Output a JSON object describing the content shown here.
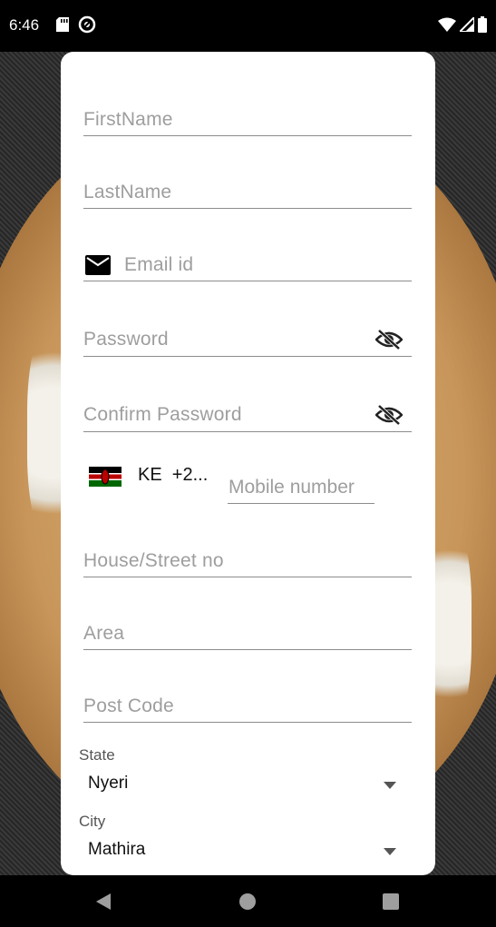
{
  "status_bar": {
    "time": "6:46"
  },
  "form": {
    "first_name": {
      "placeholder": "FirstName"
    },
    "last_name": {
      "placeholder": "LastName"
    },
    "email": {
      "placeholder": "Email id",
      "icon": "mail-icon"
    },
    "password": {
      "placeholder": "Password",
      "icon": "eye-off-icon"
    },
    "confirm_password": {
      "placeholder": "Confirm Password",
      "icon": "eye-off-icon"
    },
    "phone": {
      "country_code": "KE  +2...",
      "placeholder": "Mobile number",
      "flag": "kenya-flag"
    },
    "house_street": {
      "placeholder": "House/Street no"
    },
    "area": {
      "placeholder": "Area"
    },
    "post_code": {
      "placeholder": "Post Code"
    },
    "state": {
      "label": "State",
      "value": "Nyeri"
    },
    "city": {
      "label": "City",
      "value": "Mathira"
    }
  },
  "colors": {
    "card": "#ffffff",
    "placeholder": "#9e9e9e",
    "underline": "#8c8c8c",
    "text": "#111111"
  }
}
